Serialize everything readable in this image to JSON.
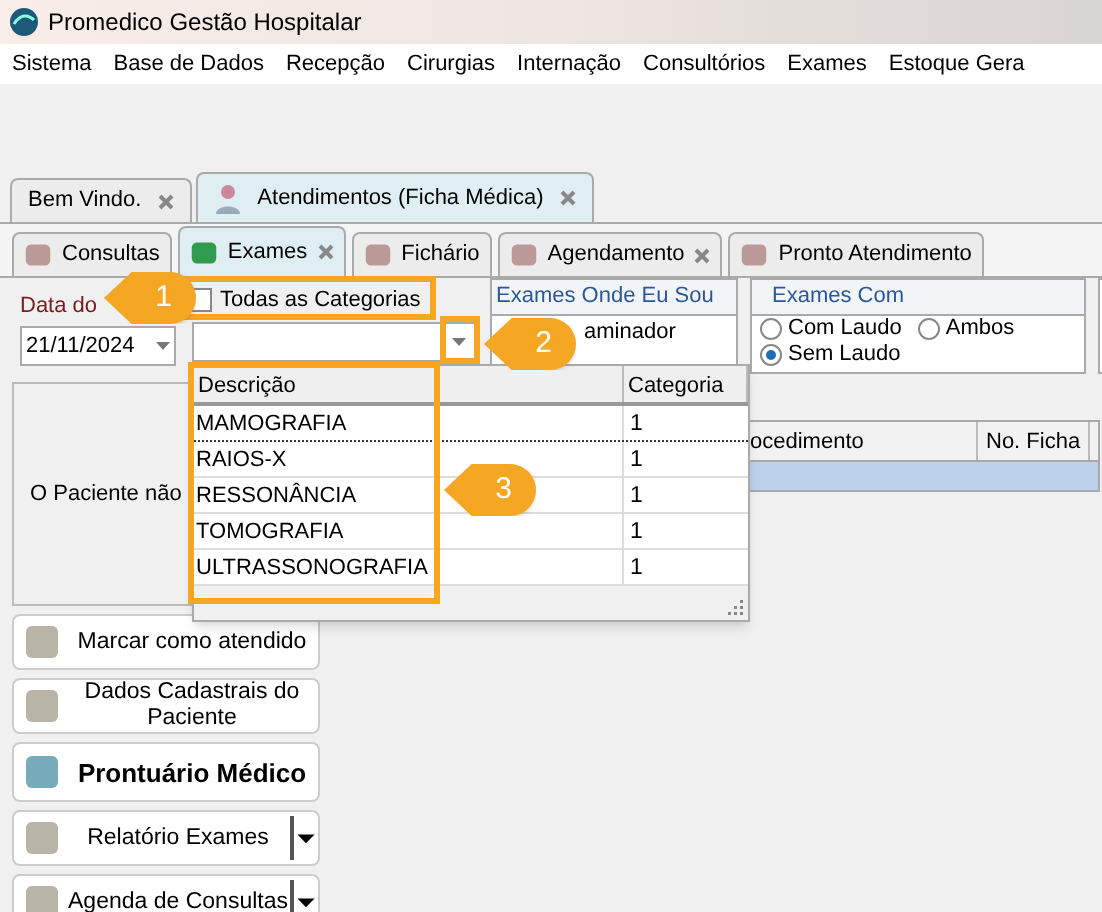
{
  "window": {
    "title": "Promedico Gestão Hospitalar"
  },
  "menu": [
    "Sistema",
    "Base de Dados",
    "Recepção",
    "Cirurgias",
    "Internação",
    "Consultórios",
    "Exames",
    "Estoque Gera"
  ],
  "outer_tabs": [
    {
      "label": "Bem Vindo.",
      "selected": false,
      "closable": true
    },
    {
      "label": "Atendimentos (Ficha Médica)",
      "selected": true,
      "closable": true
    }
  ],
  "inner_tabs": [
    {
      "label": "Consultas",
      "selected": false,
      "closable": false
    },
    {
      "label": "Exames",
      "selected": true,
      "closable": true
    },
    {
      "label": "Fichário",
      "selected": false,
      "closable": false
    },
    {
      "label": "Agendamento",
      "selected": false,
      "closable": true
    },
    {
      "label": "Pronto Atendimento",
      "selected": false,
      "closable": false
    }
  ],
  "date_label": "Data do",
  "date_value": "21/11/2024",
  "all_categories": {
    "label": "Todas as Categorias",
    "checked": false
  },
  "group_onde": {
    "title": "Exames Onde Eu Sou",
    "options": [
      "aminador"
    ]
  },
  "group_com": {
    "title": "Exames Com",
    "options": [
      {
        "label": "Com Laudo",
        "selected": false
      },
      {
        "label": "Ambos",
        "selected": false
      },
      {
        "label": "Sem Laudo",
        "selected": true
      }
    ]
  },
  "patient_message": "O Paciente não",
  "table_behind": {
    "columns": [
      "ocedimento",
      "No. Ficha"
    ]
  },
  "dropdown": {
    "columns": [
      "Descrição",
      "Categoria"
    ],
    "rows": [
      {
        "descricao": "MAMOGRAFIA",
        "categoria": "1",
        "selected": true
      },
      {
        "descricao": "RAIOS-X",
        "categoria": "1",
        "selected": false
      },
      {
        "descricao": "RESSONÂNCIA",
        "categoria": "1",
        "selected": false
      },
      {
        "descricao": "TOMOGRAFIA",
        "categoria": "1",
        "selected": false
      },
      {
        "descricao": "ULTRASSONOGRAFIA",
        "categoria": "1",
        "selected": false
      }
    ]
  },
  "actions": [
    {
      "label": "Marcar como atendido",
      "kind": "plain"
    },
    {
      "label": "Dados Cadastrais do Paciente",
      "kind": "plain"
    },
    {
      "label": "Prontuário Médico",
      "kind": "bold"
    },
    {
      "label": "Relatório Exames",
      "kind": "split"
    },
    {
      "label": "Agenda de Consultas",
      "kind": "split"
    }
  ],
  "callouts": [
    "1",
    "2",
    "3"
  ]
}
